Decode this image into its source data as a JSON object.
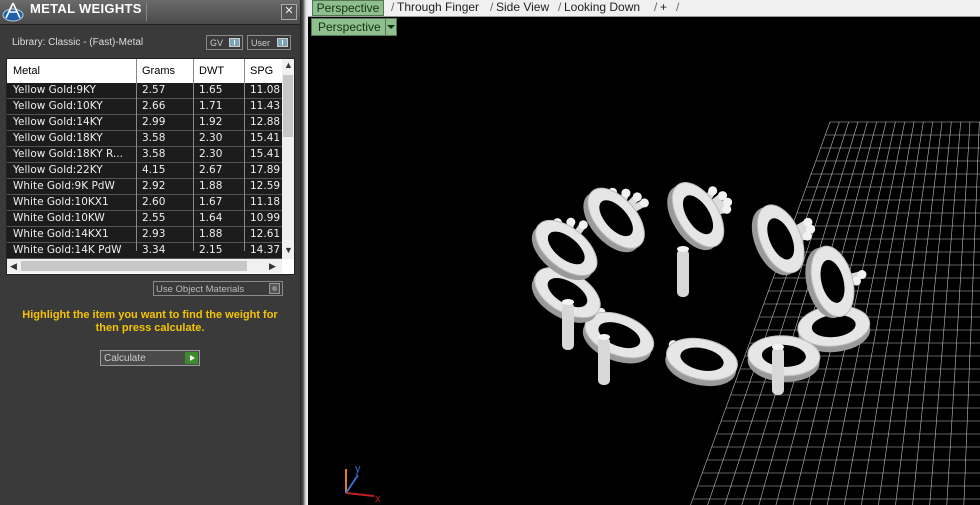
{
  "panel": {
    "title": "METAL WEIGHTS",
    "close_label": "✕",
    "library_label": "Library: Classic - (Fast)-Metal",
    "toggle_gv": "GV",
    "toggle_user": "User",
    "use_object_materials": "Use Object Materials",
    "hint": "Highlight the item you want to find the weight for then press calculate.",
    "calculate_label": "Calculate"
  },
  "table": {
    "columns": [
      "Metal",
      "Grams",
      "DWT",
      "SPG"
    ],
    "rows": [
      [
        "Yellow Gold:9KY",
        "2.57",
        "1.65",
        "11.08"
      ],
      [
        "Yellow Gold:10KY",
        "2.66",
        "1.71",
        "11.43"
      ],
      [
        "Yellow Gold:14KY",
        "2.99",
        "1.92",
        "12.88"
      ],
      [
        "Yellow Gold:18KY",
        "3.58",
        "2.30",
        "15.41"
      ],
      [
        "Yellow Gold:18KY R...",
        "3.58",
        "2.30",
        "15.41"
      ],
      [
        "Yellow Gold:22KY",
        "4.15",
        "2.67",
        "17.89"
      ],
      [
        "White Gold:9K PdW",
        "2.92",
        "1.88",
        "12.59"
      ],
      [
        "White Gold:10KX1",
        "2.60",
        "1.67",
        "11.18"
      ],
      [
        "White Gold:10KW",
        "2.55",
        "1.64",
        "10.99"
      ],
      [
        "White Gold:14KX1",
        "2.93",
        "1.88",
        "12.61"
      ],
      [
        "White Gold:14K PdW",
        "3.34",
        "2.15",
        "14.37"
      ]
    ]
  },
  "viewport": {
    "tabs": [
      "Perspective",
      "Through Finger",
      "Side View",
      "Looking Down"
    ],
    "add_tab": "+",
    "dropdown_label": "Perspective",
    "axis_x": "x",
    "axis_y": "y"
  },
  "colors": {
    "hint": "#f5c400",
    "active_tab": "#8fbf8f",
    "calculate_go": "#3e8a2f"
  }
}
